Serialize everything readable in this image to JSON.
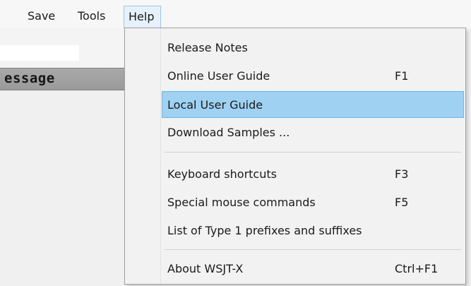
{
  "menubar": {
    "items": [
      {
        "label": "Save"
      },
      {
        "label": "Tools"
      },
      {
        "label": "Help"
      }
    ]
  },
  "background": {
    "header_label": "essage"
  },
  "help_menu": {
    "items": [
      {
        "label": "Release Notes",
        "shortcut": ""
      },
      {
        "label": "Online User Guide",
        "shortcut": "F1"
      },
      {
        "label": "Local User Guide",
        "shortcut": "",
        "highlighted": true
      },
      {
        "label": "Download Samples ...",
        "shortcut": ""
      },
      {
        "label": "Keyboard shortcuts",
        "shortcut": "F3"
      },
      {
        "label": "Special mouse commands",
        "shortcut": "F5"
      },
      {
        "label": "List of Type 1 prefixes and suffixes",
        "shortcut": ""
      },
      {
        "label": "About WSJT-X",
        "shortcut": "Ctrl+F1"
      }
    ]
  },
  "colors": {
    "highlight": "#9fd1f2",
    "highlight_border": "#6ab6ea",
    "menubar_active": "#e6f1fb"
  }
}
